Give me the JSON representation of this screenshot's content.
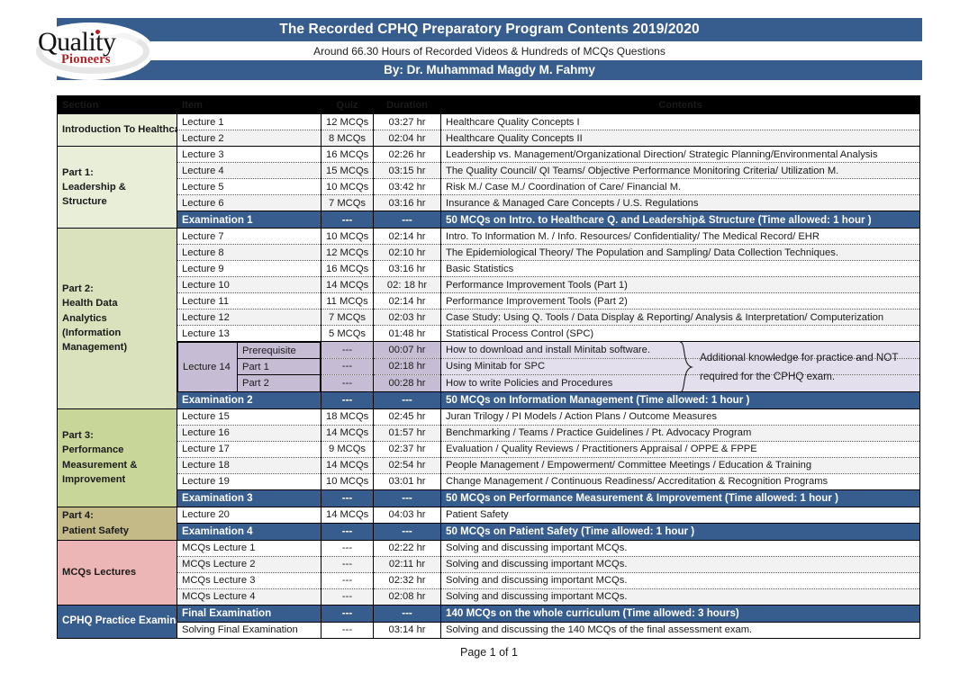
{
  "header": {
    "title": "The Recorded CPHQ Preparatory Program Contents 2019/2020",
    "subtitle": "Around 66.30 Hours of Recorded Videos & Hundreds of MCQs Questions",
    "author": "By: Dr. Muhammad Magdy M. Fahmy",
    "logo": {
      "word1": "Quality",
      "word2": "Pioneers"
    },
    "accent_blue": "#375d8e"
  },
  "table": {
    "columns": [
      "Section",
      "Item",
      "Quiz",
      "Duration",
      "Contents"
    ],
    "groups": [
      {
        "section": "Introduction To Healthcare Quality",
        "color": "#e8eed8",
        "rows": [
          {
            "item": "Lecture 1",
            "quiz": "12 MCQs",
            "duration": "03:27 hr",
            "contents": "Healthcare Quality Concepts I",
            "alt": false
          },
          {
            "item": "Lecture 2",
            "quiz": "8 MCQs",
            "duration": "02:04 hr",
            "contents": "Healthcare Quality Concepts II",
            "alt": true
          }
        ]
      },
      {
        "section": "Part 1:\nLeadership &\nStructure",
        "color": "#e8eed8",
        "rows": [
          {
            "item": "Lecture 3",
            "quiz": "16 MCQs",
            "duration": "02:26 hr",
            "contents": "Leadership vs. Management/Organizational Direction/ Strategic Planning/Environmental Analysis",
            "alt": false
          },
          {
            "item": "Lecture 4",
            "quiz": "15 MCQs",
            "duration": "03:15 hr",
            "contents": "The Quality Council/ QI Teams/ Objective Performance Monitoring Criteria/ Utilization M.",
            "alt": true
          },
          {
            "item": "Lecture 5",
            "quiz": "10 MCQs",
            "duration": "03:42 hr",
            "contents": "Risk M./ Case M./ Coordination of Care/ Financial M.",
            "alt": false
          },
          {
            "item": "Lecture 6",
            "quiz": "7 MCQs",
            "duration": "03:16 hr",
            "contents": "Insurance & Managed Care Concepts / U.S. Regulations",
            "alt": true
          },
          {
            "item": "Examination 1",
            "quiz": "---",
            "duration": "---",
            "contents": "50 MCQs on Intro. to Healthcare Q. and Leadership& Structure (Time allowed: 1 hour )",
            "exam": true
          }
        ]
      },
      {
        "section": "Part 2:\nHealth Data\nAnalytics\n(Information\nManagement)",
        "color": "#d9e2bc",
        "rows": [
          {
            "item": "Lecture 7",
            "quiz": "10 MCQs",
            "duration": "02:14 hr",
            "contents": "Intro. To Information M. / Info. Resources/ Confidentiality/ The Medical Record/ EHR",
            "alt": false
          },
          {
            "item": "Lecture 8",
            "quiz": "12 MCQs",
            "duration": "02:10 hr",
            "contents": "The Epidemiological Theory/ The Population and Sampling/ Data Collection Techniques.",
            "alt": true
          },
          {
            "item": "Lecture 9",
            "quiz": "16 MCQs",
            "duration": "03:16 hr",
            "contents": "Basic Statistics",
            "alt": false
          },
          {
            "item": "Lecture 10",
            "quiz": "14 MCQs",
            "duration": "02: 18 hr",
            "contents": "Performance Improvement Tools (Part 1)",
            "alt": true
          },
          {
            "item": "Lecture 11",
            "quiz": "11 MCQs",
            "duration": "02:14 hr",
            "contents": "Performance Improvement Tools (Part 2)",
            "alt": false
          },
          {
            "item": "Lecture 12",
            "quiz": "7 MCQs",
            "duration": "02:03 hr",
            "contents": "Case Study: Using Q. Tools / Data Display & Reporting/ Analysis & Interpretation/ Computerization",
            "alt": true
          },
          {
            "item": "Lecture 13",
            "quiz": "5 MCQs",
            "duration": "01:48 hr",
            "contents": "Statistical Process Control (SPC)",
            "alt": false
          }
        ],
        "lecture14": {
          "label": "Lecture 14",
          "subrows": [
            {
              "sub": "Prerequisite",
              "quiz": "---",
              "duration": "00:07 hr",
              "contents": "How to download and install Minitab software."
            },
            {
              "sub": "Part 1",
              "quiz": "---",
              "duration": "02:18 hr",
              "contents": "Using Minitab for SPC"
            },
            {
              "sub": "Part 2",
              "quiz": "---",
              "duration": "00:28 hr",
              "contents": "How to write Policies and Procedures"
            }
          ],
          "annotation": "Additional knowledge for practice and NOT required for the CPHQ exam."
        },
        "exam": {
          "item": "Examination 2",
          "quiz": "---",
          "duration": "---",
          "contents": "50 MCQs on Information Management (Time allowed: 1 hour )"
        }
      },
      {
        "section": "Part 3:\nPerformance\nMeasurement &\nImprovement",
        "color": "#c9d69a",
        "rows": [
          {
            "item": "Lecture 15",
            "quiz": "18 MCQs",
            "duration": "02:45 hr",
            "contents": "Juran Trilogy / PI Models / Action Plans / Outcome Measures",
            "alt": false
          },
          {
            "item": "Lecture 16",
            "quiz": "14 MCQs",
            "duration": "01:57 hr",
            "contents": "Benchmarking / Teams / Practice Guidelines / Pt. Advocacy Program",
            "alt": true
          },
          {
            "item": "Lecture 17",
            "quiz": "9 MCQs",
            "duration": "02:37 hr",
            "contents": "Evaluation / Quality Reviews / Practitioners Appraisal / OPPE & FPPE",
            "alt": false
          },
          {
            "item": "Lecture 18",
            "quiz": "14 MCQs",
            "duration": "02:54 hr",
            "contents": "People Management / Empowerment/ Committee Meetings / Education & Training",
            "alt": true
          },
          {
            "item": "Lecture 19",
            "quiz": "10 MCQs",
            "duration": "03:01 hr",
            "contents": "Change Management / Continuous Readiness/ Accreditation & Recognition Programs",
            "alt": false
          },
          {
            "item": "Examination 3",
            "quiz": "---",
            "duration": "---",
            "contents": "50 MCQs on Performance Measurement & Improvement (Time allowed: 1 hour )",
            "exam": true
          }
        ]
      },
      {
        "section": "Part 4:\nPatient Safety",
        "color": "#c3ba88",
        "rows": [
          {
            "item": "Lecture 20",
            "quiz": "14 MCQs",
            "duration": "04:03 hr",
            "contents": "Patient Safety",
            "alt": false
          },
          {
            "item": "Examination 4",
            "quiz": "---",
            "duration": "---",
            "contents": "50 MCQs on Patient Safety (Time allowed: 1 hour )",
            "exam": true
          }
        ]
      },
      {
        "section": "MCQs Lectures",
        "color": "#edb6b6",
        "rows": [
          {
            "item": "MCQs Lecture 1",
            "quiz": "---",
            "duration": "02:22 hr",
            "contents": "Solving and discussing important MCQs.",
            "alt": false
          },
          {
            "item": "MCQs Lecture 2",
            "quiz": "---",
            "duration": "02:11 hr",
            "contents": "Solving and discussing important MCQs.",
            "alt": true
          },
          {
            "item": "MCQs Lecture 3",
            "quiz": "---",
            "duration": "02:32 hr",
            "contents": "Solving and discussing important MCQs.",
            "alt": false
          },
          {
            "item": "MCQs Lecture 4",
            "quiz": "---",
            "duration": "02:08 hr",
            "contents": "Solving and discussing important MCQs.",
            "alt": true
          }
        ]
      },
      {
        "section": "CPHQ Practice Examination",
        "color": "#edb6b6",
        "rows": [
          {
            "item": "Final Examination",
            "quiz": "---",
            "duration": "---",
            "contents": "140 MCQs on the whole curriculum (Time allowed: 3 hours)",
            "exam": true
          },
          {
            "item": "Solving Final Examination",
            "quiz": "---",
            "duration": "03:14 hr",
            "contents": "Solving and discussing the 140 MCQs of the final assessment exam.",
            "alt": false
          }
        ]
      }
    ]
  },
  "footer": {
    "page": "Page 1 of 1"
  }
}
